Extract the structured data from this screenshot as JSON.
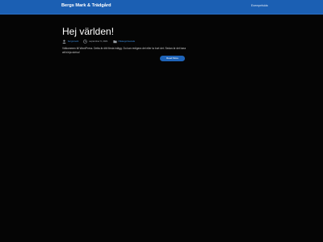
{
  "header": {
    "site_title": "Bergs Mark & Trädgård",
    "nav_link": "Exempelsida"
  },
  "post": {
    "title": "Hej världen!",
    "author": "bergsmark",
    "date": "september 9, 2021",
    "category": "Okategoriserade",
    "excerpt": "Välkommen till WordPress. Detta är ditt första inlägg. Du kan redigera det eller ta bort det. Sedan är det bara att börja skriva!",
    "read_more": "Read More"
  },
  "colors": {
    "header_bg": "#1b5fb3",
    "page_bg": "#050505",
    "accent": "#1e63b8",
    "link": "#3d8fe0"
  },
  "icons": {
    "author": "user-icon",
    "date": "clock-icon",
    "category": "folder-icon"
  }
}
